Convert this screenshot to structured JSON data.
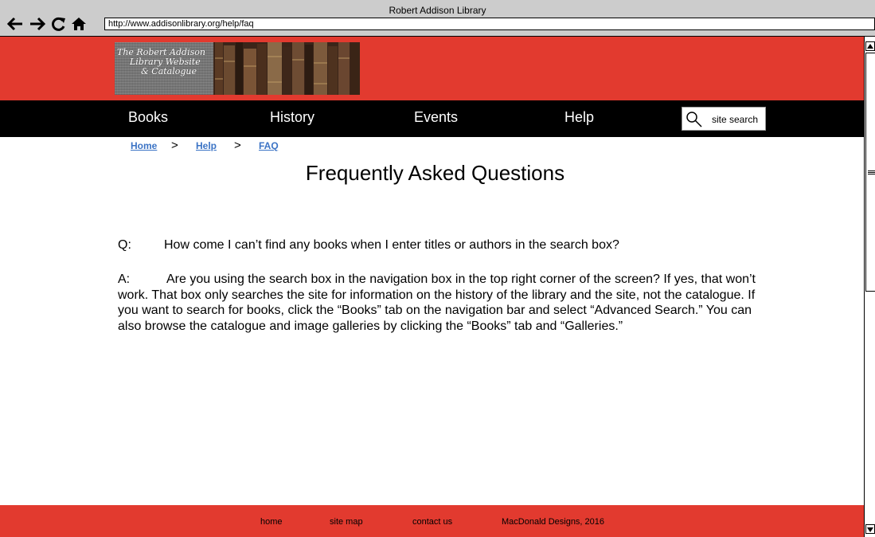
{
  "browser": {
    "window_title": "Robert Addison Library",
    "url": "http://www.addisonlibrary.org/help/faq"
  },
  "logo": {
    "lines": [
      "The Robert Addison",
      "Library Website",
      "& Catalogue"
    ]
  },
  "nav": {
    "items": [
      {
        "label": "Books"
      },
      {
        "label": "History"
      },
      {
        "label": "Events"
      },
      {
        "label": "Help"
      }
    ],
    "search_placeholder": "site search"
  },
  "breadcrumb": {
    "items": [
      {
        "label": "Home"
      },
      {
        "label": "Help"
      },
      {
        "label": "FAQ"
      }
    ],
    "separator": ">"
  },
  "page_title": "Frequently Asked Questions",
  "faq": {
    "q_label": "Q:",
    "question": "How come I can’t find any books when I enter titles or authors in the search box?",
    "a_label": "A:",
    "answer": "Are you using the search box in the navigation box in the top right corner of the screen? If yes, that won’t work. That box only searches the site for information on the history of the library and the site, not the catalogue. If you want to search for books, click the “Books” tab on the navigation bar and select “Advanced Search.” You can also browse the catalogue and image galleries by clicking the “Books” tab and “Galleries.”"
  },
  "footer": {
    "links": [
      {
        "label": "home"
      },
      {
        "label": "site map"
      },
      {
        "label": "contact us"
      }
    ],
    "copyright": "MacDonald Designs, 2016"
  },
  "colors": {
    "brand_red": "#e23a2f",
    "nav_bg": "#000000",
    "link_blue": "#3b73c5",
    "chrome_gray": "#cccccc"
  }
}
